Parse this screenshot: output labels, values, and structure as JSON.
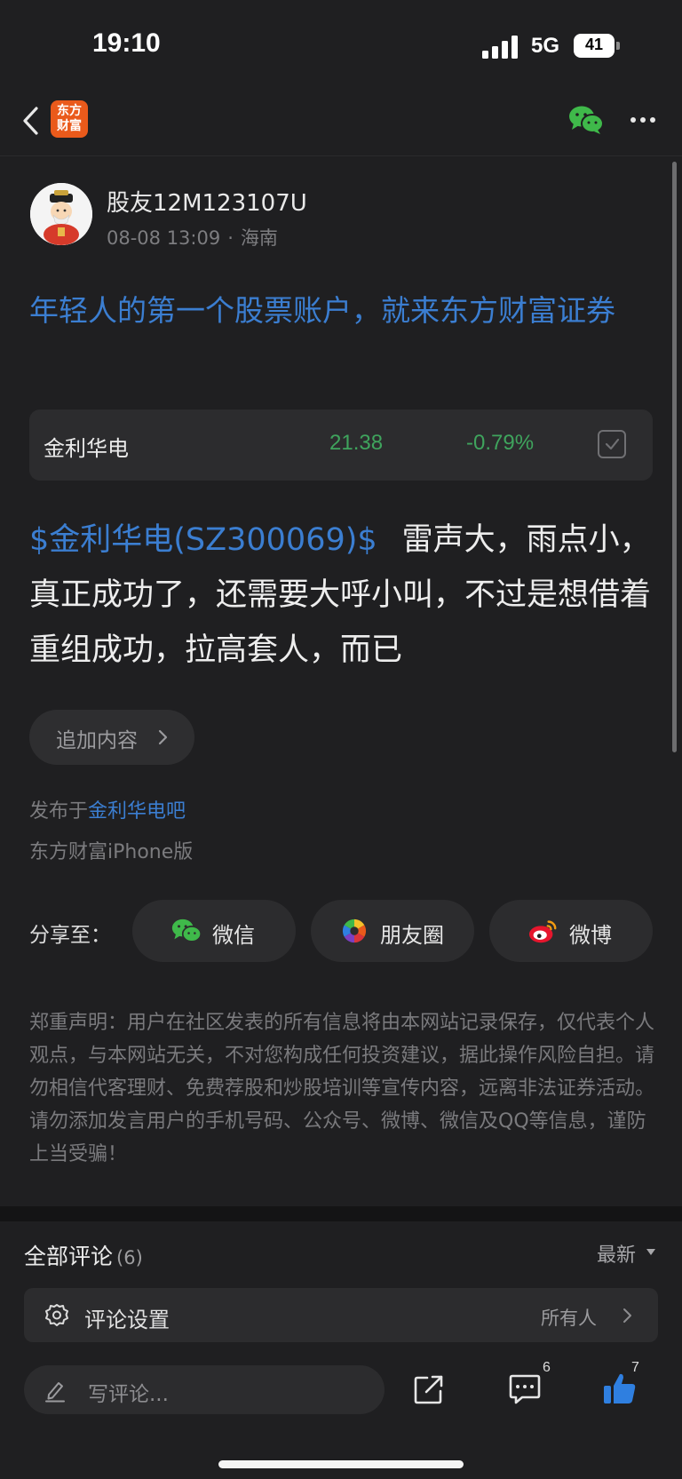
{
  "status_bar": {
    "time": "19:10",
    "network": "5G",
    "battery": "41"
  },
  "nav": {
    "brand_line1": "东方",
    "brand_line2": "财富",
    "back_icon": "chevron-left-icon",
    "share_icon": "wechat-icon",
    "more_icon": "more-dots-icon"
  },
  "post": {
    "author": "股友12M123107U",
    "date": "08-08 13:09",
    "separator": "·",
    "location": "海南",
    "promo_title": "年轻人的第一个股票账户，就来东方财富证券",
    "stock": {
      "name": "金利华电",
      "price": "21.38",
      "change": "-0.79%",
      "color": "#3fa45d"
    },
    "tag": "$金利华电(SZ300069)$",
    "body": "雷声大，雨点小，真正成功了，还需要大呼小叫，不过是想借着重组成功，拉高套人，而已",
    "append_label": "追加内容",
    "published_prefix": "发布于",
    "forum_name": "金利华电吧",
    "client": "东方财富iPhone版"
  },
  "share": {
    "label": "分享至：",
    "targets": [
      {
        "label": "微信",
        "icon": "wechat-icon"
      },
      {
        "label": "朋友圈",
        "icon": "moments-icon"
      },
      {
        "label": "微博",
        "icon": "weibo-icon"
      }
    ]
  },
  "disclaimer": "郑重声明：用户在社区发表的所有信息将由本网站记录保存，仅代表个人观点，与本网站无关，不对您构成任何投资建议，据此操作风险自担。请勿相信代客理财、免费荐股和炒股培训等宣传内容，远离非法证券活动。请勿添加发言用户的手机号码、公众号、微博、微信及QQ等信息，谨防上当受骗！",
  "comments": {
    "title": "全部评论",
    "count": "(6)",
    "sort": "最新",
    "settings_label": "评论设置",
    "settings_value": "所有人",
    "compose_placeholder": "写评论...",
    "comment_badge": "6",
    "like_badge": "7"
  },
  "colors": {
    "accent_blue": "#3b7ed1",
    "stock_green": "#3fa45d",
    "brand_orange": "#ea5a1b",
    "background": "#1f1f21"
  }
}
